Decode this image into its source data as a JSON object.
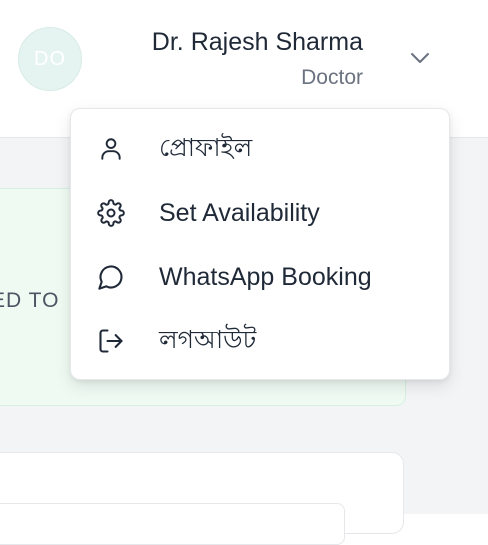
{
  "header": {
    "avatar_initials": "DO",
    "user_name": "Dr. Rajesh Sharma",
    "user_role": "Doctor"
  },
  "main": {
    "banner_text": "ED TO"
  },
  "menu": {
    "items": [
      {
        "label": "প্রোফাইল",
        "icon": "user-icon"
      },
      {
        "label": "Set Availability",
        "icon": "gear-icon"
      },
      {
        "label": "WhatsApp Booking",
        "icon": "chat-bubble-icon"
      },
      {
        "label": "লগআউট",
        "icon": "logout-icon"
      }
    ]
  },
  "colors": {
    "banner_bg": "#effaf3",
    "avatar_bg": "#e6f4f1",
    "muted_text": "#6b7280"
  }
}
